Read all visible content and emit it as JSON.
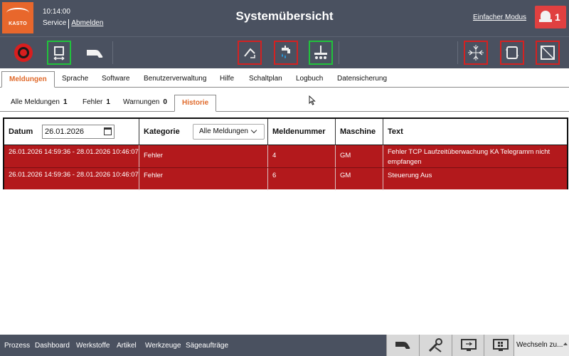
{
  "header": {
    "logo_text": "KASTO",
    "time": "10:14:00",
    "user": "Service",
    "logout": "Abmelden",
    "title": "Systemübersicht",
    "simple_mode": "Einfacher Modus",
    "alarm_count": "1"
  },
  "toolbar": {
    "left": [
      {
        "name": "stop-button",
        "icon": "emergency-stop-icon",
        "frame": "none"
      },
      {
        "name": "door-toggle-button",
        "icon": "door-icon",
        "frame": "green"
      },
      {
        "name": "hand-mode-button",
        "icon": "hand-icon",
        "frame": "none"
      }
    ],
    "center": [
      {
        "name": "feed-button",
        "icon": "feed-icon",
        "frame": "red"
      },
      {
        "name": "coolant-button",
        "icon": "coolant-icon",
        "frame": "red"
      },
      {
        "name": "clamp-button",
        "icon": "clamp-icon",
        "frame": "green"
      }
    ],
    "right": [
      {
        "name": "center-button",
        "icon": "center-icon",
        "frame": "red"
      },
      {
        "name": "frame-button",
        "icon": "frame-icon",
        "frame": "red"
      },
      {
        "name": "diagonal-button",
        "icon": "diagonal-icon",
        "frame": "red"
      }
    ]
  },
  "tabs": [
    "Meldungen",
    "Sprache",
    "Software",
    "Benutzerverwaltung",
    "Hilfe",
    "Schaltplan",
    "Logbuch",
    "Datensicherung"
  ],
  "active_tab": "Meldungen",
  "subtabs": [
    {
      "label": "Alle Meldungen",
      "count": "1"
    },
    {
      "label": "Fehler",
      "count": "1"
    },
    {
      "label": "Warnungen",
      "count": "0"
    },
    {
      "label": "Historie",
      "count": ""
    }
  ],
  "active_subtab": "Historie",
  "table": {
    "headers": {
      "datum": "Datum",
      "kategorie": "Kategorie",
      "meldenummer": "Meldenummer",
      "maschine": "Maschine",
      "text": "Text"
    },
    "date_value": "26.01.2026",
    "category_value": "Alle Meldungen",
    "rows": [
      {
        "date": "26.01.2026 14:59:36 - 28.01.2026 10:46:07",
        "category": "Fehler",
        "number": "4",
        "machine": "GM",
        "text": "Fehler TCP Laufzeitüberwachung KA Telegramm nicht empfangen"
      },
      {
        "date": "26.01.2026 14:59:36 - 28.01.2026 10:46:07",
        "category": "Fehler",
        "number": "6",
        "machine": "GM",
        "text": "Steuerung Aus"
      }
    ]
  },
  "bottom": {
    "links": [
      "Prozess",
      "Dashboard",
      "Werkstoffe",
      "Artikel",
      "Werkzeuge",
      "Sägeaufträge"
    ],
    "switch_label": "Wechseln zu..."
  },
  "colors": {
    "accent": "#e06a2b",
    "header": "#4a5160",
    "error_row": "#b3191c",
    "red_frame": "#d32222",
    "green_frame": "#21c23c"
  }
}
